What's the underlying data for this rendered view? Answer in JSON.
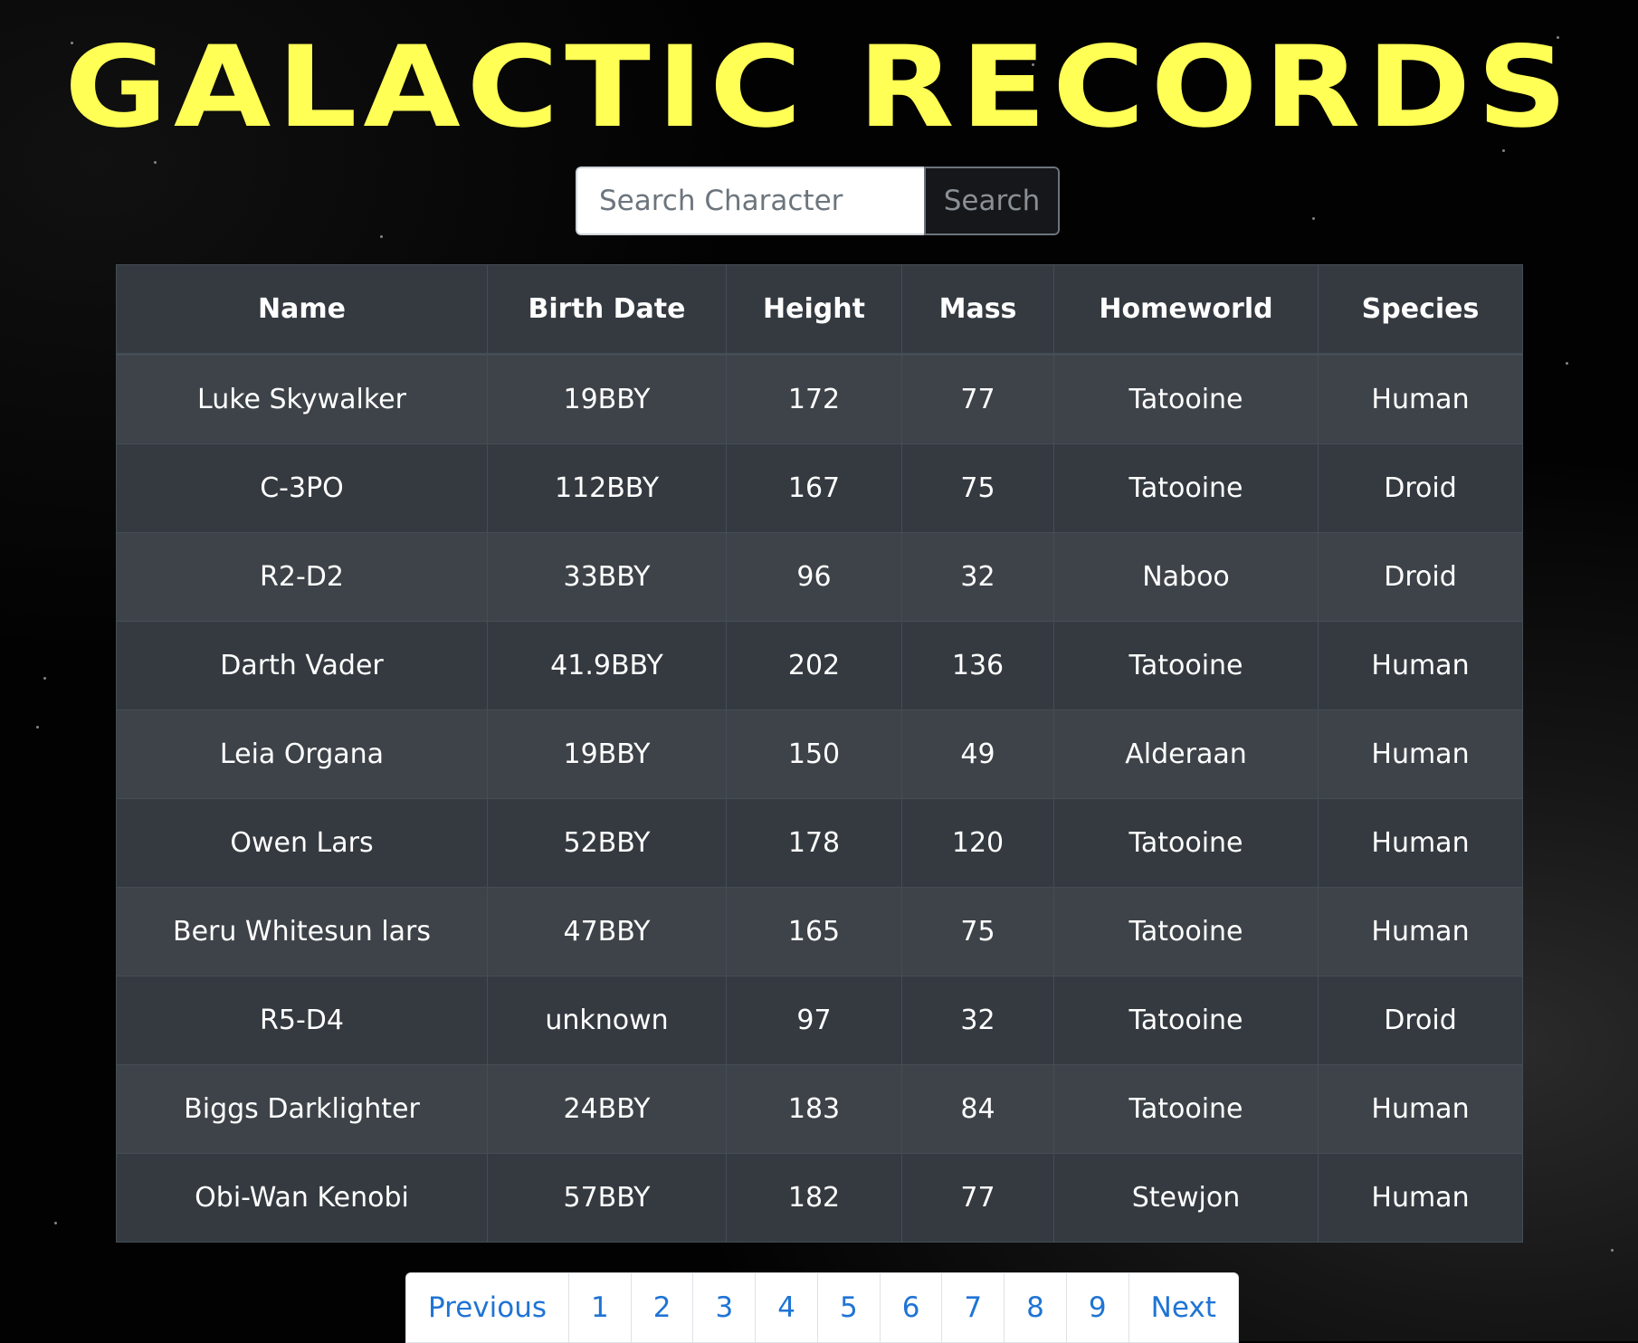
{
  "header": {
    "title": "GALACTIC RECORDS"
  },
  "search": {
    "placeholder": "Search Character",
    "value": "",
    "button_label": "Search"
  },
  "table": {
    "columns": [
      "Name",
      "Birth Date",
      "Height",
      "Mass",
      "Homeworld",
      "Species"
    ],
    "rows": [
      [
        "Luke Skywalker",
        "19BBY",
        "172",
        "77",
        "Tatooine",
        "Human"
      ],
      [
        "C-3PO",
        "112BBY",
        "167",
        "75",
        "Tatooine",
        "Droid"
      ],
      [
        "R2-D2",
        "33BBY",
        "96",
        "32",
        "Naboo",
        "Droid"
      ],
      [
        "Darth Vader",
        "41.9BBY",
        "202",
        "136",
        "Tatooine",
        "Human"
      ],
      [
        "Leia Organa",
        "19BBY",
        "150",
        "49",
        "Alderaan",
        "Human"
      ],
      [
        "Owen Lars",
        "52BBY",
        "178",
        "120",
        "Tatooine",
        "Human"
      ],
      [
        "Beru Whitesun lars",
        "47BBY",
        "165",
        "75",
        "Tatooine",
        "Human"
      ],
      [
        "R5-D4",
        "unknown",
        "97",
        "32",
        "Tatooine",
        "Droid"
      ],
      [
        "Biggs Darklighter",
        "24BBY",
        "183",
        "84",
        "Tatooine",
        "Human"
      ],
      [
        "Obi-Wan Kenobi",
        "57BBY",
        "182",
        "77",
        "Stewjon",
        "Human"
      ]
    ]
  },
  "pagination": {
    "previous_label": "Previous",
    "pages": [
      "1",
      "2",
      "3",
      "4",
      "5",
      "6",
      "7",
      "8",
      "9"
    ],
    "next_label": "Next"
  },
  "colors": {
    "title": "#ffff55",
    "link": "#1f74d4",
    "table_header": "#343a40",
    "table_row_odd": "#3d4348",
    "table_row_even": "#343a40"
  }
}
